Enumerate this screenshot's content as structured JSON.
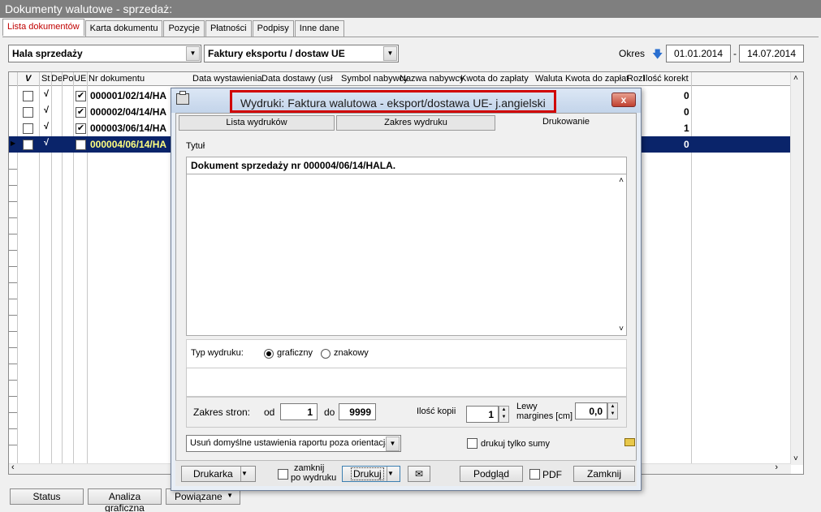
{
  "window": {
    "title": "Dokumenty walutowe - sprzedaż:"
  },
  "tabs": [
    "Lista dokumentów",
    "Karta dokumentu",
    "Pozycje",
    "Płatności",
    "Podpisy",
    "Inne dane"
  ],
  "filters": {
    "warehouse": "Hala sprzedaży",
    "doc_type": "Faktury eksportu / dostaw UE",
    "period_label": "Okres",
    "date_from": "01.01.2014",
    "date_sep": "-",
    "date_to": "14.07.2014"
  },
  "grid": {
    "headers": [
      "V",
      "St",
      "De",
      "Po",
      "UE",
      "Nr dokumentu",
      "Data wystawienia",
      "Data dostawy (usł",
      "Symbol nabywcy",
      "Nazwa nabywcy",
      "Kwota do zapłaty",
      "Waluta",
      "Kwota do zapłat",
      "Rozl",
      "Ilość korekt"
    ],
    "rows": [
      {
        "nr": "000001/02/14/HA",
        "st": "√",
        "ue": "✔",
        "korekt": "0"
      },
      {
        "nr": "000002/04/14/HA",
        "st": "√",
        "ue": "✔",
        "korekt": "0"
      },
      {
        "nr": "000003/06/14/HA",
        "st": "√",
        "ue": "✔",
        "korekt": "1"
      },
      {
        "nr": "000004/06/14/HA",
        "st": "√",
        "ue": "",
        "korekt": "0"
      }
    ]
  },
  "bottom": {
    "status": "Status",
    "analiza": "Analiza graficzna",
    "powiazane": "Powiązane"
  },
  "dialog": {
    "title": "Wydruki: Faktura walutowa - eksport/dostawa UE- j.angielski",
    "close": "x",
    "tabs": [
      "Lista wydruków",
      "Zakres wydruku",
      "Drukowanie"
    ],
    "tytul_label": "Tytuł",
    "tytul_value": "Dokument sprzedaży nr 000004/06/14/HALA.",
    "typ_label": "Typ wydruku:",
    "typ_options": [
      "graficzny",
      "znakowy"
    ],
    "zakres_label": "Zakres stron:",
    "od_label": "od",
    "od_value": "1",
    "do_label": "do",
    "do_value": "9999",
    "kopie_label": "Ilość kopii",
    "kopie_value": "1",
    "margines_label": "Lewy margines [cm]",
    "margines_value": "0,0",
    "reset_label": "Usuń domyślne ustawienia raportu poza orientacją p",
    "sumy_label": "drukuj tylko sumy",
    "drukarka": "Drukarka",
    "zamknij_po_line1": "zamknij",
    "zamknij_po_line2": "po wydruku",
    "drukuj": "Drukuj",
    "podglad": "Podgląd",
    "pdf": "PDF",
    "zamknij": "Zamknij"
  }
}
